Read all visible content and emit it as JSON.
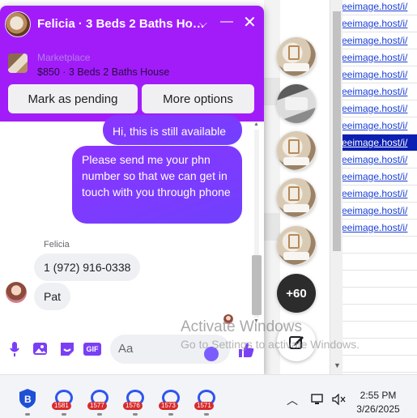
{
  "background": {
    "links": [
      "eeimage.host/i/",
      "eeimage.host/i/",
      "eeimage.host/i/",
      "eeimage.host/i/",
      "eeimage.host/i/",
      "eeimage.host/i/",
      "eeimage.host/i/",
      "eeimage.host/i/",
      "eeimage.host/i/",
      "eeimage.host/i/",
      "eeimage.host/i/",
      "eeimage.host/i/",
      "eeimage.host/i/",
      "eeimage.host/i/"
    ],
    "selected_link_index": 8
  },
  "chat_heads": {
    "more_count": "+60"
  },
  "chat": {
    "title": "Felicia · 3 Beds 2 Baths Ho…",
    "header_color": "#a21cfa",
    "marketplace_label": "Marketplace",
    "listing": "$850 · 3 Beds 2 Baths House",
    "mark_pending_label": "Mark as pending",
    "more_options_label": "More options",
    "messages": {
      "out_1": "Hi, this is still available",
      "out_2": "Please send me your phn number so that we can get in touch with you through phone",
      "sender_name": "Felicia",
      "in_1": "1 (972) 916-0338",
      "in_2": "Pat"
    },
    "composer": {
      "placeholder": "Aa",
      "gif_label": "GIF"
    }
  },
  "watermark": {
    "title": "Activate Windows",
    "subtitle": "Go to Settings to activate Windows."
  },
  "taskbar": {
    "badges": [
      "1581",
      "1577",
      "1576",
      "1573",
      "1571"
    ],
    "time": "2:55 PM",
    "date": "3/26/2025"
  }
}
